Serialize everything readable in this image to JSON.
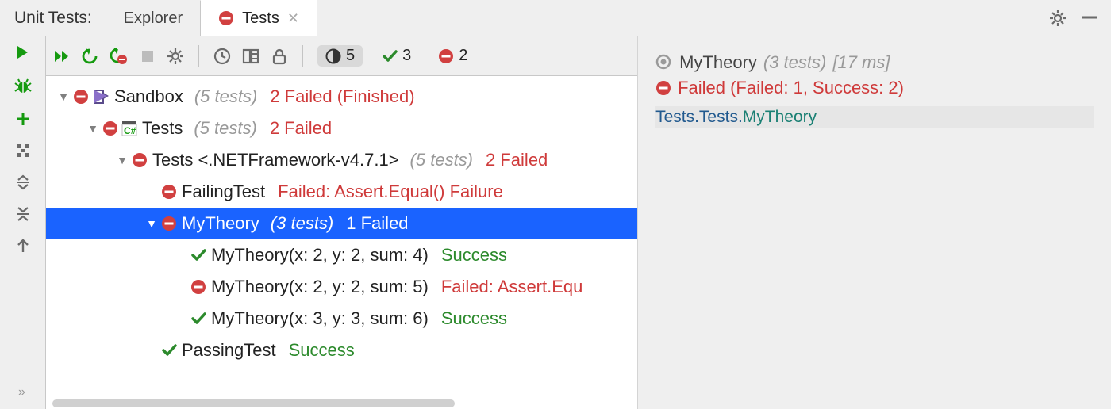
{
  "header": {
    "title": "Unit Tests:",
    "tabs": [
      {
        "label": "Explorer",
        "active": false
      },
      {
        "label": "Tests",
        "active": true,
        "closable": true
      }
    ]
  },
  "filters": {
    "total": 5,
    "passed": 3,
    "failed": 2
  },
  "tree": [
    {
      "depth": 0,
      "arrow": "▼",
      "status": "fail",
      "icon": "project",
      "name": "Sandbox",
      "count_text": "(5 tests)",
      "result": "2 Failed (Finished)",
      "result_type": "fail"
    },
    {
      "depth": 1,
      "arrow": "▼",
      "status": "fail",
      "icon": "csharp",
      "name": "Tests",
      "count_text": "(5 tests)",
      "result": "2 Failed",
      "result_type": "fail"
    },
    {
      "depth": 2,
      "arrow": "▼",
      "status": "fail",
      "icon": "",
      "name": "Tests <.NETFramework-v4.7.1>",
      "count_text": "(5 tests)",
      "result": "2 Failed",
      "result_type": "fail"
    },
    {
      "depth": 3,
      "arrow": "",
      "status": "fail",
      "icon": "",
      "name": "FailingTest",
      "count_text": "",
      "result": "Failed: Assert.Equal() Failure",
      "result_type": "fail"
    },
    {
      "depth": 3,
      "arrow": "▼",
      "status": "fail",
      "icon": "",
      "name": "MyTheory",
      "count_text": "(3 tests)",
      "result": "1 Failed",
      "result_type": "fail",
      "selected": true
    },
    {
      "depth": 4,
      "arrow": "",
      "status": "pass",
      "icon": "",
      "name": "MyTheory(x: 2, y: 2, sum: 4)",
      "count_text": "",
      "result": "Success",
      "result_type": "pass"
    },
    {
      "depth": 4,
      "arrow": "",
      "status": "fail",
      "icon": "",
      "name": "MyTheory(x: 2, y: 2, sum: 5)",
      "count_text": "",
      "result": "Failed: Assert.Equ",
      "result_type": "fail"
    },
    {
      "depth": 4,
      "arrow": "",
      "status": "pass",
      "icon": "",
      "name": "MyTheory(x: 3, y: 3, sum: 6)",
      "count_text": "",
      "result": "Success",
      "result_type": "pass"
    },
    {
      "depth": 3,
      "arrow": "",
      "status": "pass",
      "icon": "",
      "name": "PassingTest",
      "count_text": "",
      "result": "Success",
      "result_type": "pass"
    }
  ],
  "detail": {
    "name": "MyTheory",
    "count_text": "(3 tests)",
    "duration": "[17 ms]",
    "status_text": "Failed (Failed: 1, Success: 2)",
    "fqn_prefix": "Tests.Tests.",
    "fqn_method": "MyTheory"
  }
}
